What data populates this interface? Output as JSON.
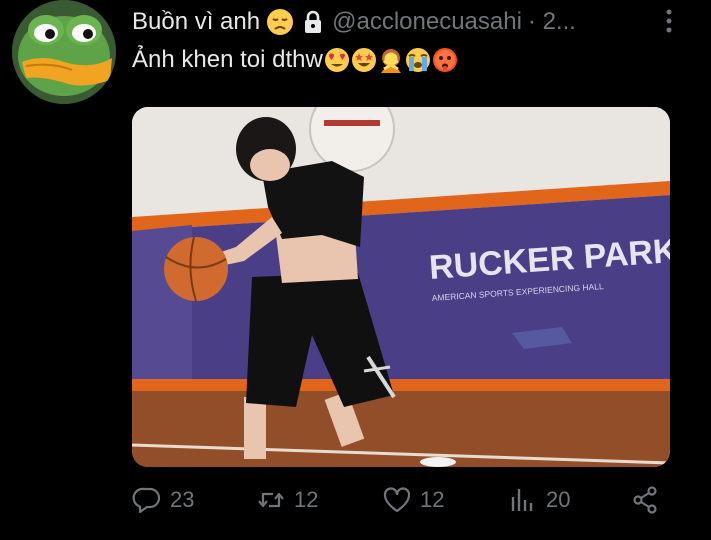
{
  "tweet": {
    "display_name": "Buồn vì anh",
    "handle": "@acclonecuasahi",
    "time_truncated": "· 2...",
    "text": "Ảnh khen toi dthw",
    "name_emoji": "disappointed-face",
    "text_emojis": [
      "heart-eyes-face",
      "star-struck-face",
      "woman-gesturing-no",
      "loudly-crying-face",
      "hot-face"
    ]
  },
  "media": {
    "sign_title": "RUCKER PARK",
    "sign_subtitle": "AMERICAN SPORTS EXPERIENCING HALL"
  },
  "actions": {
    "reply_count": "23",
    "retweet_count": "12",
    "like_count": "12",
    "views_count": "20"
  },
  "colors": {
    "background": "#000000",
    "text_primary": "#e7e9ea",
    "text_secondary": "#71767b",
    "accent_orange": "#e2651c",
    "wall_purple": "#4a3f86"
  }
}
